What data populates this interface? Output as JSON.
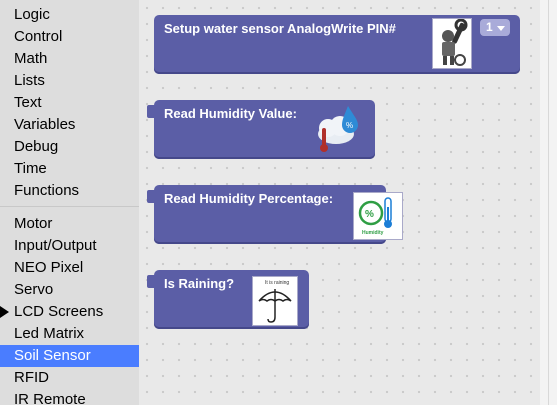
{
  "sidebar": {
    "categories_top": [
      "Logic",
      "Control",
      "Math",
      "Lists",
      "Text",
      "Variables",
      "Debug",
      "Time",
      "Functions"
    ],
    "categories_bottom": [
      "Motor",
      "Input/Output",
      "NEO Pixel",
      "Servo",
      "LCD Screens",
      "Led Matrix",
      "Soil Sensor",
      "RFID",
      "IR Remote"
    ],
    "selected": "Soil Sensor",
    "expanded": "LCD Screens"
  },
  "blocks": {
    "setup": {
      "label": "Setup water sensor  AnalogWrite PIN#",
      "pin_value": "1",
      "icon": "wrench-robot-icon"
    },
    "humidity": {
      "label": "Read Humidity Value:",
      "icon": "cloud-thermometer-drop-icon"
    },
    "percentage": {
      "label": "Read Humidity Percentage:",
      "icon": "humidity-gauge-icon",
      "icon_text": "Humidity"
    },
    "raining": {
      "label": "Is Raining?",
      "icon": "umbrella-icon",
      "icon_text": "It is raining"
    }
  },
  "colors": {
    "block": "#5b5ea6",
    "selected_category": "#4a7dff",
    "sidebar": "#dddddd"
  }
}
